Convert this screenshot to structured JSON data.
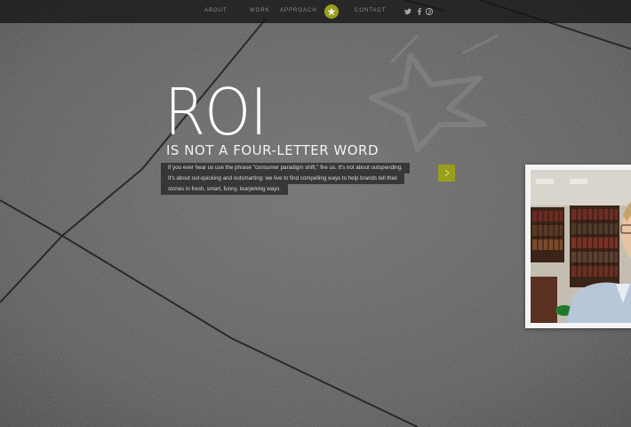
{
  "nav": {
    "items": [
      {
        "label": "ABOUT"
      },
      {
        "label": "WORK"
      },
      {
        "label": "APPROACH"
      },
      {
        "label": "CONTACT"
      }
    ],
    "logo_icon": "star-icon",
    "social": [
      {
        "icon": "twitter-icon"
      },
      {
        "icon": "facebook-icon"
      },
      {
        "icon": "pinterest-icon"
      }
    ]
  },
  "hero": {
    "title": "ROI",
    "subtitle": "IS NOT A FOUR-LETTER WORD",
    "body_lines": [
      "If you ever hear us use the phrase \"consumer paradigm shift,\" fire us. It's not about outspending.",
      "It's about out-quicking and outsmarting: we live to find compelling ways to help brands tell their",
      "stories in fresh, smart, funny, tearjerking ways."
    ],
    "next_icon": "chevron-right-icon"
  },
  "colors": {
    "accent": "#98a01b",
    "nav_bg": "#141414",
    "text": "#ffffff"
  }
}
